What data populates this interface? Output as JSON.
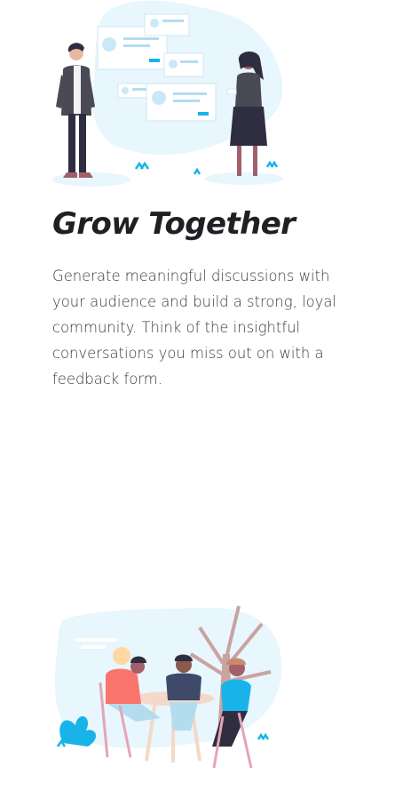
{
  "feature": {
    "title": "Grow Together",
    "description": "Generate meaningful discussions with your audience and build a strong, loyal community. Think of the insightful conversations you miss out on with a feedback form."
  },
  "illustrations": {
    "top": "people-presenting-illustration",
    "bottom": "group-discussion-illustration"
  },
  "colors": {
    "blob": "#e8f6fd",
    "accent": "#18b4e9",
    "text": "#1f1f24"
  }
}
